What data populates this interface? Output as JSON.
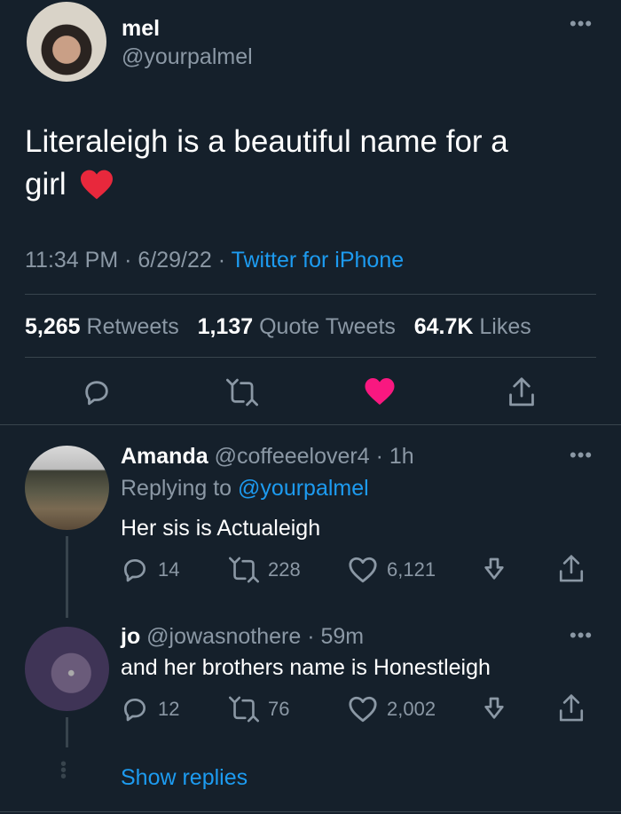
{
  "tweet": {
    "author_name": "mel",
    "author_handle": "@yourpalmel",
    "text_line1": "Literaleigh is a beautiful name for a",
    "text_line2": "girl",
    "time": "11:34 PM",
    "date": "6/29/22",
    "source": "Twitter for iPhone",
    "retweets_count": "5,265",
    "retweets_label": "Retweets",
    "quotes_count": "1,137",
    "quotes_label": "Quote Tweets",
    "likes_count": "64.7K",
    "likes_label": "Likes",
    "liked": true
  },
  "replies": [
    {
      "name": "Amanda",
      "handle": "@coffeeelover4",
      "time": "1h",
      "replying_prefix": "Replying to",
      "replying_handle": "@yourpalmel",
      "text": "Her sis is Actualeigh",
      "reply_count": "14",
      "retweet_count": "228",
      "like_count": "6,121"
    },
    {
      "name": "jo",
      "handle": "@jowasnothere",
      "time": "59m",
      "text": "and her brothers name is Honestleigh",
      "reply_count": "12",
      "retweet_count": "76",
      "like_count": "2,002"
    }
  ],
  "show_replies_label": "Show replies",
  "colors": {
    "background": "#15202b",
    "accent": "#1d9bf0",
    "like": "#f91880",
    "muted": "#8b98a5"
  }
}
